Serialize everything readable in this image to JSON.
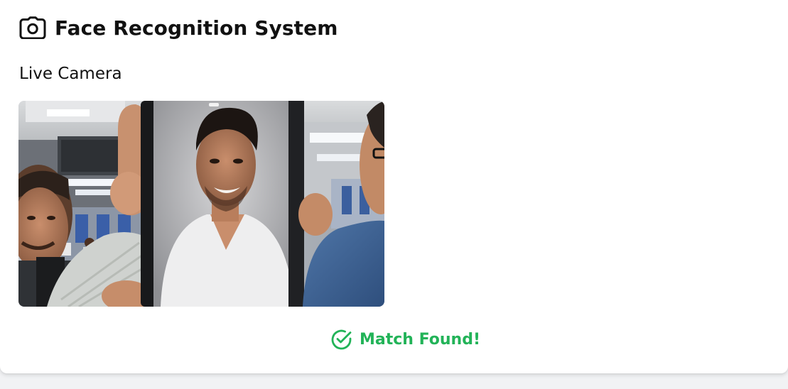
{
  "app": {
    "title": "Face Recognition System",
    "title_icon": "camera-icon"
  },
  "camera": {
    "section_title": "Live Camera",
    "feed": "live-camera-feed"
  },
  "status": {
    "text": "Match Found!",
    "icon": "check-circle-icon",
    "color": "#22b358"
  },
  "colors": {
    "background": "#f1f2f4",
    "card": "#ffffff",
    "text": "#111111"
  }
}
